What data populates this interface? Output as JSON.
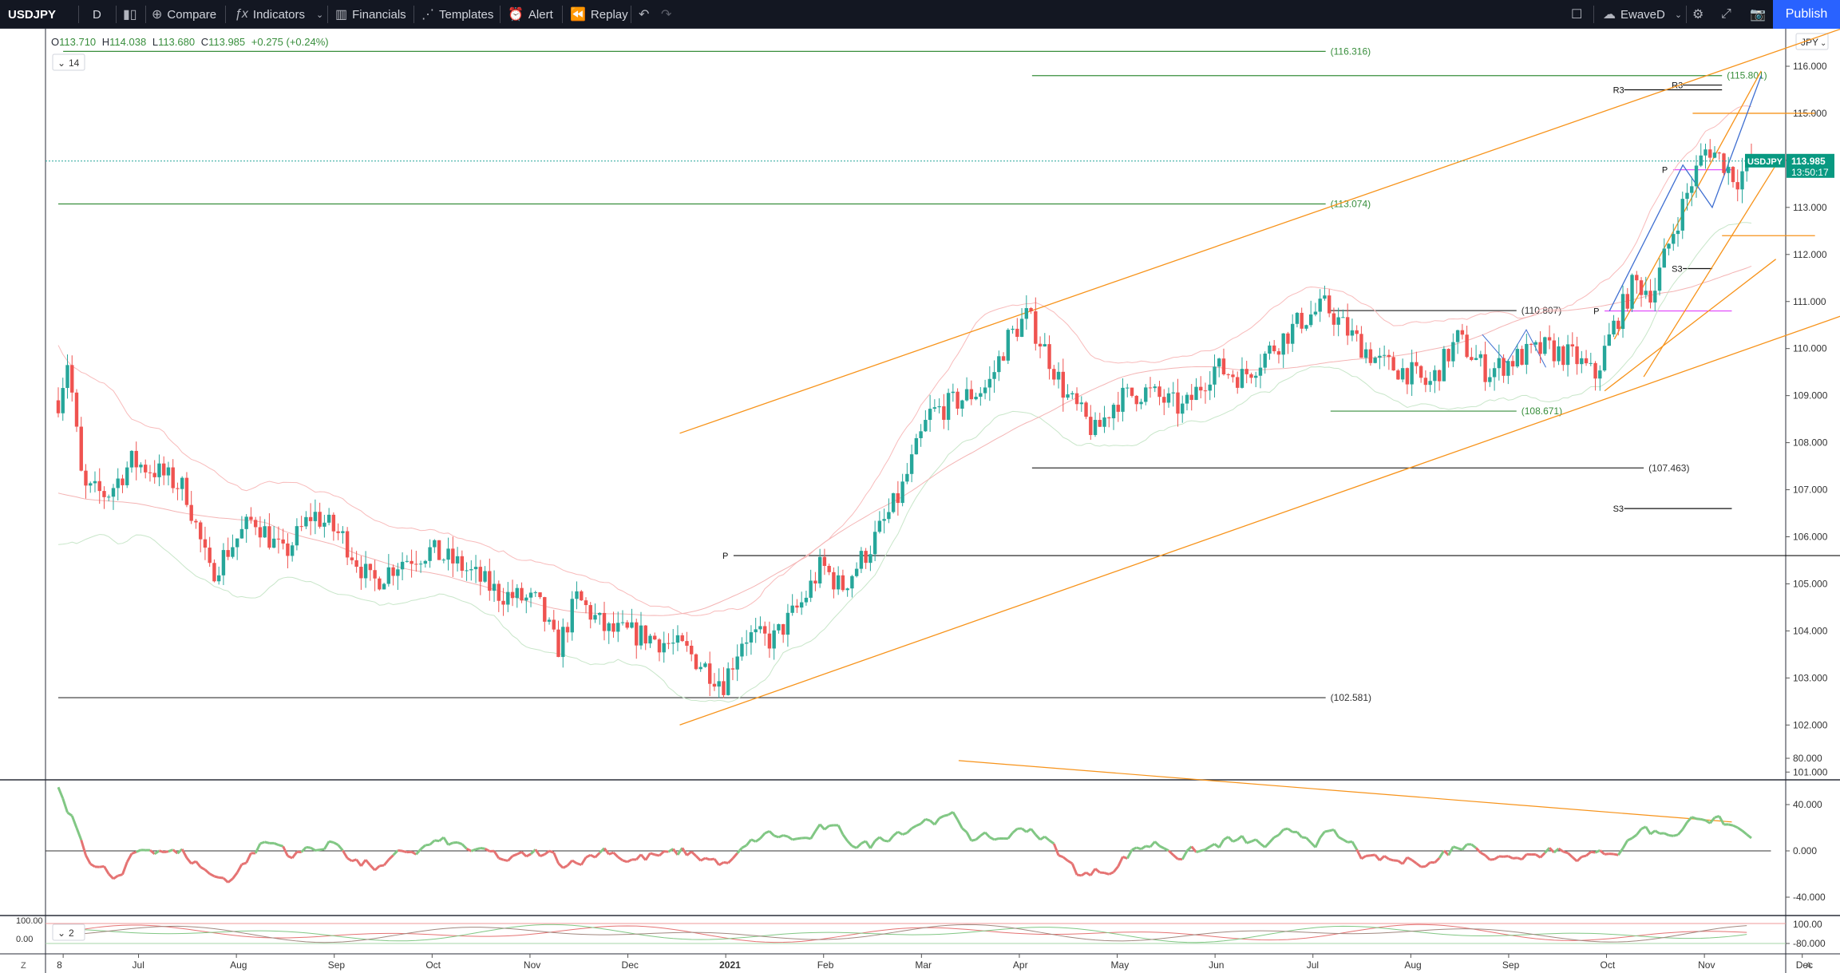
{
  "toolbar": {
    "symbol": "USDJPY",
    "interval": "D",
    "compare": "Compare",
    "indicators": "Indicators",
    "financials": "Financials",
    "templates": "Templates",
    "alert": "Alert",
    "replay": "Replay",
    "layout_name": "EwaveD",
    "publish": "Publish"
  },
  "legend": {
    "o_label": "O",
    "o": "113.710",
    "h_label": "H",
    "h": "114.038",
    "l_label": "L",
    "l": "113.680",
    "c_label": "C",
    "c": "113.985",
    "change": "+0.275 (+0.24%)",
    "study_param": "14",
    "stoch_param": "2"
  },
  "currency_button": "JPY",
  "price_badge": {
    "symbol": "USDJPY",
    "price": "113.985",
    "countdown": "13:50:17"
  },
  "colors": {
    "up": "#26a69a",
    "down": "#ef5350",
    "trend": "#f7931a",
    "pivot_magenta": "#e040fb",
    "level_green": "#388e3c",
    "accent": "#2962ff",
    "osc_green": "#81c784",
    "osc_red": "#e57373"
  },
  "chart_data": {
    "type": "candlestick",
    "symbol": "USDJPY",
    "interval": "D",
    "price_axis": {
      "ylim": [
        100.6,
        116.5
      ],
      "ticks": [
        "116.000",
        "115.000",
        "114.000",
        "113.000",
        "112.000",
        "111.000",
        "110.000",
        "109.000",
        "108.000",
        "107.000",
        "106.000",
        "105.000",
        "104.000",
        "103.000",
        "102.000",
        "101.000"
      ]
    },
    "time_axis": {
      "labels": [
        {
          "t": "8",
          "m": 0.05
        },
        {
          "t": "Jul",
          "m": 0.82
        },
        {
          "t": "Aug",
          "m": 1.82
        },
        {
          "t": "Sep",
          "m": 2.82
        },
        {
          "t": "Oct",
          "m": 3.82
        },
        {
          "t": "Nov",
          "m": 4.82
        },
        {
          "t": "Dec",
          "m": 5.82
        },
        {
          "t": "2021",
          "m": 6.82
        },
        {
          "t": "Feb",
          "m": 7.82
        },
        {
          "t": "Mar",
          "m": 8.82
        },
        {
          "t": "Apr",
          "m": 9.82
        },
        {
          "t": "May",
          "m": 10.82
        },
        {
          "t": "Jun",
          "m": 11.82
        },
        {
          "t": "Jul",
          "m": 12.82
        },
        {
          "t": "Aug",
          "m": 13.82
        },
        {
          "t": "Sep",
          "m": 14.82
        },
        {
          "t": "Oct",
          "m": 15.82
        },
        {
          "t": "Nov",
          "m": 16.82
        },
        {
          "t": "Dec",
          "m": 17.82
        }
      ]
    },
    "price_path": [
      {
        "m": 0.0,
        "p": 108.9
      },
      {
        "m": 0.1,
        "p": 109.8
      },
      {
        "m": 0.25,
        "p": 107.0
      },
      {
        "m": 0.5,
        "p": 106.9
      },
      {
        "m": 0.75,
        "p": 107.6
      },
      {
        "m": 1.0,
        "p": 107.4
      },
      {
        "m": 1.3,
        "p": 107.0
      },
      {
        "m": 1.55,
        "p": 105.2
      },
      {
        "m": 1.8,
        "p": 105.9
      },
      {
        "m": 2.0,
        "p": 106.4
      },
      {
        "m": 2.3,
        "p": 105.6
      },
      {
        "m": 2.6,
        "p": 106.5
      },
      {
        "m": 2.9,
        "p": 106.0
      },
      {
        "m": 3.2,
        "p": 105.0
      },
      {
        "m": 3.5,
        "p": 105.5
      },
      {
        "m": 3.8,
        "p": 105.7
      },
      {
        "m": 4.1,
        "p": 105.4
      },
      {
        "m": 4.5,
        "p": 104.8
      },
      {
        "m": 4.9,
        "p": 104.6
      },
      {
        "m": 5.1,
        "p": 103.6
      },
      {
        "m": 5.3,
        "p": 104.7
      },
      {
        "m": 5.6,
        "p": 104.0
      },
      {
        "m": 6.0,
        "p": 103.9
      },
      {
        "m": 6.4,
        "p": 103.6
      },
      {
        "m": 6.8,
        "p": 102.9
      },
      {
        "m": 7.0,
        "p": 103.9
      },
      {
        "m": 7.3,
        "p": 103.8
      },
      {
        "m": 7.6,
        "p": 104.6
      },
      {
        "m": 7.8,
        "p": 105.4
      },
      {
        "m": 8.0,
        "p": 104.9
      },
      {
        "m": 8.3,
        "p": 105.8
      },
      {
        "m": 8.6,
        "p": 106.9
      },
      {
        "m": 8.9,
        "p": 108.6
      },
      {
        "m": 9.2,
        "p": 108.9
      },
      {
        "m": 9.5,
        "p": 109.2
      },
      {
        "m": 9.7,
        "p": 110.2
      },
      {
        "m": 9.9,
        "p": 110.7
      },
      {
        "m": 10.1,
        "p": 109.9
      },
      {
        "m": 10.3,
        "p": 109.0
      },
      {
        "m": 10.6,
        "p": 108.2
      },
      {
        "m": 10.8,
        "p": 108.9
      },
      {
        "m": 11.1,
        "p": 109.1
      },
      {
        "m": 11.5,
        "p": 108.7
      },
      {
        "m": 11.8,
        "p": 109.6
      },
      {
        "m": 12.1,
        "p": 109.4
      },
      {
        "m": 12.4,
        "p": 110.0
      },
      {
        "m": 12.7,
        "p": 110.6
      },
      {
        "m": 12.95,
        "p": 110.9
      },
      {
        "m": 13.2,
        "p": 110.3
      },
      {
        "m": 13.5,
        "p": 109.7
      },
      {
        "m": 13.8,
        "p": 109.5
      },
      {
        "m": 14.0,
        "p": 109.2
      },
      {
        "m": 14.3,
        "p": 110.2
      },
      {
        "m": 14.6,
        "p": 109.5
      },
      {
        "m": 14.9,
        "p": 109.8
      },
      {
        "m": 15.2,
        "p": 110.0
      },
      {
        "m": 15.5,
        "p": 109.8
      },
      {
        "m": 15.7,
        "p": 109.4
      },
      {
        "m": 15.9,
        "p": 110.5
      },
      {
        "m": 16.1,
        "p": 111.4
      },
      {
        "m": 16.3,
        "p": 111.2
      },
      {
        "m": 16.5,
        "p": 112.5
      },
      {
        "m": 16.7,
        "p": 113.6
      },
      {
        "m": 16.85,
        "p": 114.3
      },
      {
        "m": 17.0,
        "p": 114.0
      },
      {
        "m": 17.15,
        "p": 113.6
      },
      {
        "m": 17.3,
        "p": 113.985
      }
    ],
    "levels": [
      {
        "label": "(116.316)",
        "price": 116.316,
        "from": 0.05,
        "to": 12.95,
        "color": "#388e3c"
      },
      {
        "label": "(115.801)",
        "price": 115.801,
        "from": 9.95,
        "to": 17.0,
        "color": "#388e3c"
      },
      {
        "label": "(113.074)",
        "price": 113.074,
        "from": 0.0,
        "to": 12.95,
        "color": "#388e3c"
      },
      {
        "label": "(110.807)",
        "price": 110.807,
        "from": 13.0,
        "to": 14.9,
        "color": "#333"
      },
      {
        "label": "(108.671)",
        "price": 108.671,
        "from": 13.0,
        "to": 14.9,
        "color": "#388e3c"
      },
      {
        "label": "(107.463)",
        "price": 107.463,
        "from": 9.95,
        "to": 16.2,
        "color": "#333"
      },
      {
        "label": "(102.581)",
        "price": 102.581,
        "from": 0.0,
        "to": 12.95,
        "color": "#333"
      }
    ],
    "pivots": [
      {
        "label": "R3",
        "price": 115.5,
        "from": 16.0,
        "to": 17.0
      },
      {
        "label": "R3",
        "price": 115.6,
        "from": 16.6,
        "to": 17.0
      },
      {
        "label": "P",
        "price": 113.8,
        "from": 16.5,
        "to": 17.1
      },
      {
        "label": "S3",
        "price": 111.7,
        "from": 16.6,
        "to": 16.9
      },
      {
        "label": "P",
        "price": 110.8,
        "from": 15.8,
        "to": 17.1
      },
      {
        "label": "S3",
        "price": 106.6,
        "from": 16.0,
        "to": 17.1
      },
      {
        "label": "P",
        "price": 105.6,
        "from": 6.9,
        "to": 18.4
      }
    ],
    "oscillator": {
      "ylim": [
        -85,
        85
      ],
      "ticks": [
        "80.000",
        "40.000",
        "0.000",
        "-40.000",
        "-80.000"
      ]
    },
    "stochastic": {
      "ticks": [
        "100.00",
        "0.00"
      ],
      "right_tick": "100.00"
    }
  }
}
